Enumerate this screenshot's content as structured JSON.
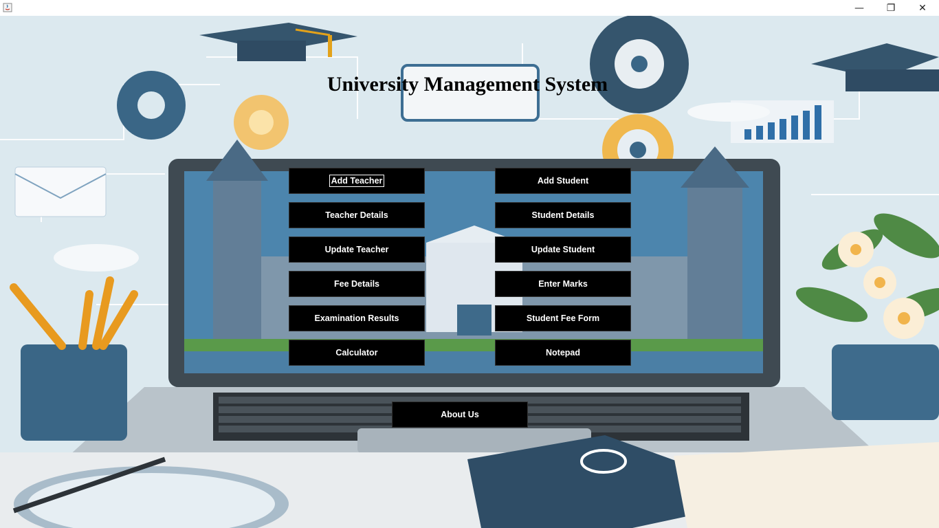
{
  "window": {
    "title": "",
    "controls": {
      "minimize": "—",
      "maximize": "❐",
      "close": "✕"
    }
  },
  "app": {
    "title": "University Management System"
  },
  "buttons": {
    "add_teacher": "Add Teacher",
    "add_student": "Add Student",
    "teacher_details": "Teacher Details",
    "student_details": "Student Details",
    "update_teacher": "Update Teacher",
    "update_student": "Update Student",
    "fee_details": "Fee Details",
    "enter_marks": "Enter Marks",
    "examination_results": "Examination Results",
    "student_fee_form": "Student Fee Form",
    "calculator": "Calculator",
    "notepad": "Notepad",
    "about_us": "About Us"
  },
  "colors": {
    "button_bg": "#000000",
    "button_text": "#ffffff",
    "title_text": "#000000",
    "scene_bg": "#dbe9f0",
    "accent_blue": "#3d6e93",
    "accent_dark": "#2f4b63"
  }
}
